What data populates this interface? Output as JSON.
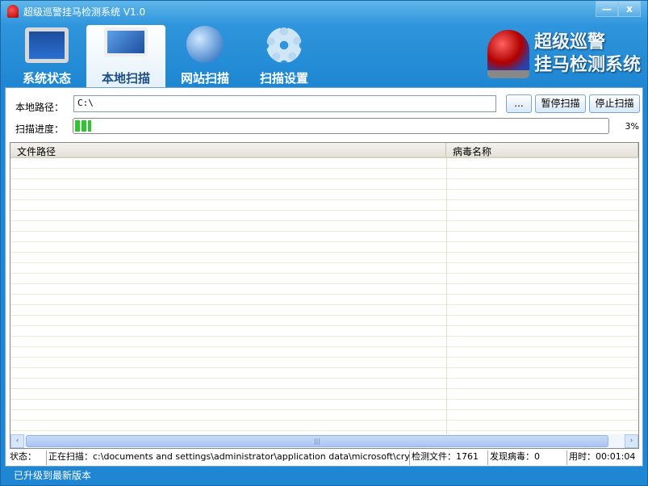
{
  "title": "超级巡警挂马检测系统 V1.0",
  "window_buttons": {
    "minimize": "—",
    "close": "x"
  },
  "tabs": [
    {
      "label": "系统状态",
      "icon": "monitor-pulse-icon"
    },
    {
      "label": "本地扫描",
      "icon": "computer-icon",
      "active": true
    },
    {
      "label": "网站扫描",
      "icon": "globe-icon"
    },
    {
      "label": "扫描设置",
      "icon": "gear-icon"
    }
  ],
  "logo": {
    "line1": "超级巡警",
    "line2": "挂马检测系统"
  },
  "scan": {
    "path_label": "本地路径：",
    "path_value": "C:\\",
    "browse_label": "...",
    "pause_label": "暂停扫描",
    "stop_label": "停止扫描",
    "progress_label": "扫描进度：",
    "progress_percent": 3,
    "progress_text": "3%"
  },
  "table": {
    "columns": [
      "文件路径",
      "病毒名称"
    ],
    "rows": []
  },
  "status": {
    "label": "状态：",
    "scanning": "正在扫描：c:\\documents and settings\\administrator\\application data\\microsoft\\cryptneturlca",
    "files": "检测文件：1761",
    "viruses": "发现病毒：0",
    "time": "用时：00:01:04"
  },
  "footer": "已升级到最新版本"
}
